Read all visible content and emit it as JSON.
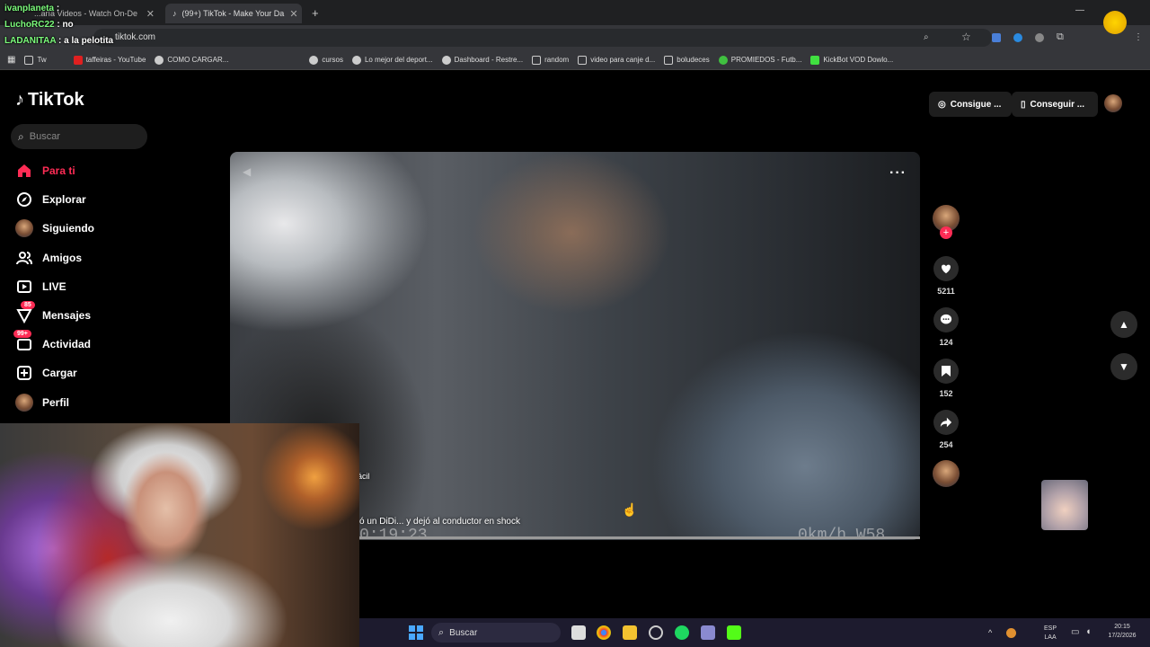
{
  "browser": {
    "tabs": [
      {
        "title": "...aría Videos - Watch On-De"
      },
      {
        "title": "(99+) TikTok - Make Your Da"
      }
    ],
    "url": "tiktok.com",
    "bookmarks": [
      {
        "label": "Tw"
      },
      {
        "label": "taffeiras - YouTube"
      },
      {
        "label": "COMO CARGAR..."
      },
      {
        "label": "cursos"
      },
      {
        "label": "Lo mejor del deport..."
      },
      {
        "label": "Dashboard - Restre..."
      },
      {
        "label": "random"
      },
      {
        "label": "video para canje d..."
      },
      {
        "label": "boludeces"
      },
      {
        "label": "PROMIEDOS - Futb..."
      },
      {
        "label": "KickBot VOD Dowlo..."
      }
    ]
  },
  "chat": [
    {
      "user": "ivanplaneta",
      "msg": ":"
    },
    {
      "user": "LuchoRC22",
      "msg": ": no"
    },
    {
      "user": "LADANITAA",
      "msg": ": a la pelotita"
    }
  ],
  "tiktok": {
    "logo": "TikTok",
    "search_placeholder": "Buscar",
    "nav": [
      {
        "label": "Para ti",
        "icon": "home-icon",
        "active": true
      },
      {
        "label": "Explorar",
        "icon": "compass-icon"
      },
      {
        "label": "Siguiendo",
        "icon": "following-avatar-icon"
      },
      {
        "label": "Amigos",
        "icon": "friends-icon"
      },
      {
        "label": "LIVE",
        "icon": "live-icon"
      },
      {
        "label": "Mensajes",
        "icon": "messages-icon",
        "badge": "85"
      },
      {
        "label": "Actividad",
        "icon": "activity-icon",
        "badge": "99+"
      },
      {
        "label": "Cargar",
        "icon": "upload-icon"
      },
      {
        "label": "Perfil",
        "icon": "profile-avatar-icon"
      }
    ],
    "header_buttons": [
      {
        "label": "Consigue ..."
      },
      {
        "label": "Conseguir ..."
      }
    ],
    "video": {
      "caption": "ó un DiDi... y dejó al conductor en shock",
      "tag": "ácil",
      "time_overlay": "0:19:23",
      "speed_overlay": "0km/h W58"
    },
    "actions": {
      "likes": "5211",
      "comments": "124",
      "saves": "152",
      "shares": "254"
    }
  },
  "taskbar": {
    "search_label": "Buscar",
    "lang": "ESP",
    "lang_sub": "LAA",
    "time": "20:15",
    "date": "17/2/2026"
  },
  "colors": {
    "accent": "#fe2c55",
    "chat_user": "#7CFC7C",
    "taskbar": "#1d1b2e"
  }
}
